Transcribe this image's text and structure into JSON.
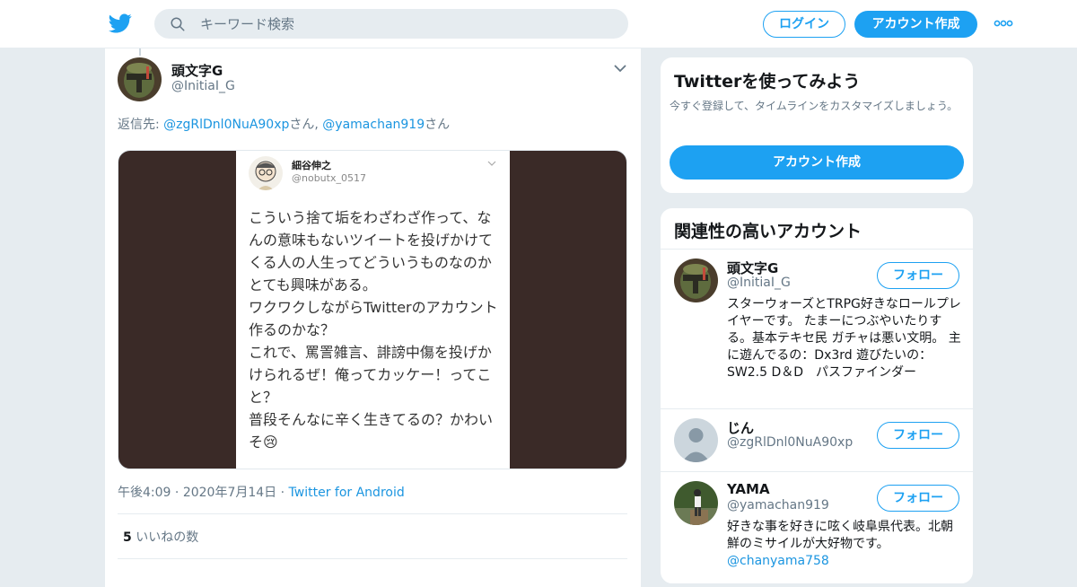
{
  "header": {
    "search_placeholder": "キーワード検索",
    "login_label": "ログイン",
    "signup_label": "アカウント作成"
  },
  "tweet": {
    "author_name": "頭文字G",
    "author_handle": "@InitiaI_G",
    "reply_prefix": "返信先: ",
    "reply_mention_1": "@zgRlDnl0NuA90xp",
    "reply_san_1": "さん",
    "reply_sep": ", ",
    "reply_mention_2": "@yamachan919",
    "reply_san_2": "さん",
    "image": {
      "name": "細谷伸之",
      "handle": "@nobutx_0517",
      "text": "こういう捨て垢をわざわざ作って、なんの意味もないツイートを投げかけてくる人の人生ってどういうものなのかとても興味がある。\nワクワクしながらTwitterのアカウント作るのかな？\nこれで、罵詈雑言、誹謗中傷を投げかけられるぜ！俺ってカッケー！ってこと？\n普段そんなに辛く生きてるの？かわいそ😢"
    },
    "time": "午後4:09",
    "date": "2020年7月14日",
    "source": "Twitter for Android",
    "likes_count": "5",
    "likes_label": "いいねの数"
  },
  "sidebar": {
    "try_title": "Twitterを使ってみよう",
    "try_desc": "今すぐ登録して、タイムラインをカスタマイズしましょう。",
    "try_button": "アカウント作成",
    "related_title": "関連性の高いアカウント",
    "accounts": [
      {
        "name": "頭文字G",
        "handle": "@InitiaI_G",
        "bio": "スターウォーズとTRPG好きなロールプレイヤーです。 たまーにつぶやいたりする。基本テキセ民 ガチャは悪い文明。 主に遊んでるの：Dx3rd 遊びたいの：SW2.5 D＆D　パスファインダー",
        "follow_label": "フォロー"
      },
      {
        "name": "じん",
        "handle": "@zgRlDnl0NuA90xp",
        "bio": "",
        "follow_label": "フォロー"
      },
      {
        "name": "YAMA",
        "handle": "@yamachan919",
        "bio": "好きな事を好きに呟く岐阜県代表。北朝鮮のミサイルが大好物です。",
        "bio_mention": "@chanyama758",
        "follow_label": "フォロー"
      }
    ]
  },
  "colors": {
    "accent": "#1da1f2",
    "link": "#1b95e0",
    "muted": "#657786",
    "background": "#e6ecf0"
  },
  "icons": [
    "twitter-bird-icon",
    "search-icon",
    "more-dots-icon",
    "chevron-down-icon",
    "default-avatar-icon"
  ]
}
